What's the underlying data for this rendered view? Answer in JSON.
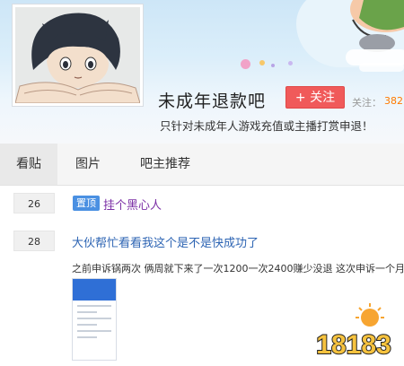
{
  "forum": {
    "name": "未成年退款吧",
    "follow_label": "+ 关注",
    "follow_count_label": "关注：",
    "follow_count": "382",
    "description": "只针对未成年人游戏充值或主播打赏申退！"
  },
  "tabs": [
    {
      "label": "看贴",
      "active": true
    },
    {
      "label": "图片",
      "active": false
    },
    {
      "label": "吧主推荐",
      "active": false
    }
  ],
  "posts": [
    {
      "reply_count": "26",
      "badge": "置顶",
      "title": "挂个黑心人"
    },
    {
      "reply_count": "28",
      "title": "大伙帮忙看看我这个是不是快成功了",
      "excerpt": "之前申诉锅两次 俩周就下来了一次1200一次2400赚少没退 这次申诉一个月..."
    }
  ],
  "watermark": {
    "text": "18183"
  },
  "colors": {
    "accent_red": "#f05a5a",
    "link_blue": "#2d64b3",
    "pinned_purple": "#7b2fa5",
    "count_orange": "#ff7a00",
    "badge_blue": "#4a90e2"
  }
}
